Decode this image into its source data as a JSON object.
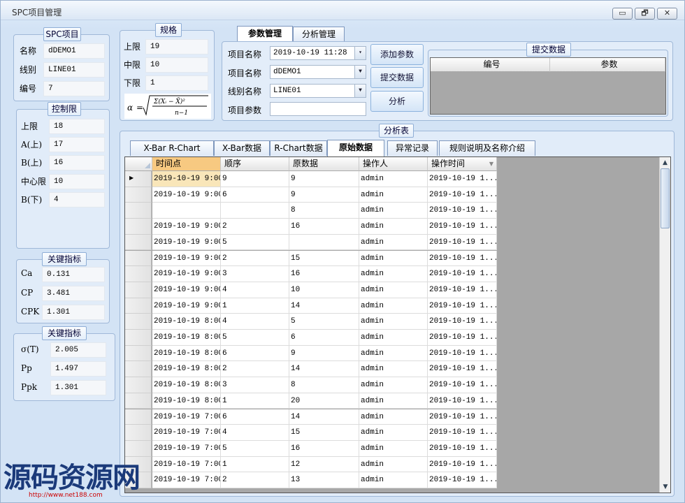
{
  "window": {
    "title": "SPC项目管理",
    "buttons": [
      "▭",
      "🗗",
      "✕"
    ]
  },
  "spc_item": {
    "legend": "SPC项目",
    "fields": [
      {
        "label": "名称",
        "value": "dDEMO1"
      },
      {
        "label": "线别",
        "value": "LINE01"
      },
      {
        "label": "编号",
        "value": "7"
      }
    ]
  },
  "control_limits": {
    "legend": "控制限",
    "fields": [
      {
        "label": "上限",
        "value": "18"
      },
      {
        "label": "A(上)",
        "value": "17"
      },
      {
        "label": "B(上)",
        "value": "16"
      },
      {
        "label": "中心限",
        "value": "10"
      },
      {
        "label": "B(下)",
        "value": "4"
      }
    ]
  },
  "key1": {
    "legend": "关键指标",
    "fields": [
      {
        "label": "Ca",
        "value": "0.131"
      },
      {
        "label": "CP",
        "value": "3.481"
      },
      {
        "label": "CPK",
        "value": "1.301"
      }
    ]
  },
  "key2": {
    "legend": "关键指标",
    "fields": [
      {
        "label": "σ(T)",
        "value": "2.005"
      },
      {
        "label": "Pp",
        "value": "1.497"
      },
      {
        "label": "Ppk",
        "value": "1.301"
      }
    ]
  },
  "spec": {
    "legend": "规格",
    "fields": [
      {
        "label": "上限",
        "value": "19"
      },
      {
        "label": "中限",
        "value": "10"
      },
      {
        "label": "下限",
        "value": "1"
      }
    ]
  },
  "tabs_top": {
    "tabs": [
      "参数管理",
      "分析管理"
    ],
    "active": 0
  },
  "param": {
    "rows": [
      {
        "label": "项目名称",
        "value": "2019-10-19 11:28"
      },
      {
        "label": "项目名称",
        "value": "dDEMO1"
      },
      {
        "label": "线别名称",
        "value": "LINE01"
      },
      {
        "label": "项目参数",
        "value": ""
      }
    ],
    "buttons": [
      "添加参数",
      "提交数据",
      "分析"
    ]
  },
  "submit": {
    "legend": "提交数据",
    "columns": [
      "编号",
      "参数"
    ]
  },
  "analysis": {
    "legend": "分析表",
    "tabs": [
      "X-Bar R-Chart",
      "X-Bar数据",
      "R-Chart数据",
      "原始数据",
      "异常记录",
      "规则说明及名称介绍"
    ],
    "active": 3,
    "columns": [
      "时间点",
      "顺序",
      "原数据",
      "操作人",
      "操作时间"
    ],
    "rows": [
      [
        "2019-10-19 9:00",
        "9",
        "9",
        "admin",
        "2019-10-19 1..."
      ],
      [
        "2019-10-19 9:00",
        "6",
        "9",
        "admin",
        "2019-10-19 1..."
      ],
      [
        "",
        "",
        "8",
        "admin",
        "2019-10-19 1..."
      ],
      [
        "2019-10-19 9:00",
        "2",
        "16",
        "admin",
        "2019-10-19 1..."
      ],
      [
        "2019-10-19 9:00",
        "5",
        "",
        "admin",
        "2019-10-19 1..."
      ],
      [
        "2019-10-19 9:00",
        "2",
        "15",
        "admin",
        "2019-10-19 1..."
      ],
      [
        "2019-10-19 9:00",
        "3",
        "16",
        "admin",
        "2019-10-19 1..."
      ],
      [
        "2019-10-19 9:00",
        "4",
        "10",
        "admin",
        "2019-10-19 1..."
      ],
      [
        "2019-10-19 9:00",
        "1",
        "14",
        "admin",
        "2019-10-19 1..."
      ],
      [
        "2019-10-19 8:00",
        "4",
        "5",
        "admin",
        "2019-10-19 1..."
      ],
      [
        "2019-10-19 8:00",
        "5",
        "6",
        "admin",
        "2019-10-19 1..."
      ],
      [
        "2019-10-19 8:00",
        "6",
        "9",
        "admin",
        "2019-10-19 1..."
      ],
      [
        "2019-10-19 8:00",
        "2",
        "14",
        "admin",
        "2019-10-19 1..."
      ],
      [
        "2019-10-19 8:00",
        "3",
        "8",
        "admin",
        "2019-10-19 1..."
      ],
      [
        "2019-10-19 8:00",
        "1",
        "20",
        "admin",
        "2019-10-19 1..."
      ],
      [
        "2019-10-19 7:00",
        "6",
        "14",
        "admin",
        "2019-10-19 1..."
      ],
      [
        "2019-10-19 7:00",
        "4",
        "15",
        "admin",
        "2019-10-19 1..."
      ],
      [
        "2019-10-19 7:00",
        "5",
        "16",
        "admin",
        "2019-10-19 1..."
      ],
      [
        "2019-10-19 7:00",
        "1",
        "12",
        "admin",
        "2019-10-19 1..."
      ],
      [
        "2019-10-19 7:00",
        "2",
        "13",
        "admin",
        "2019-10-19 1..."
      ]
    ]
  },
  "watermark": {
    "text": "源码资源网",
    "url": "http://www.net188.com"
  }
}
